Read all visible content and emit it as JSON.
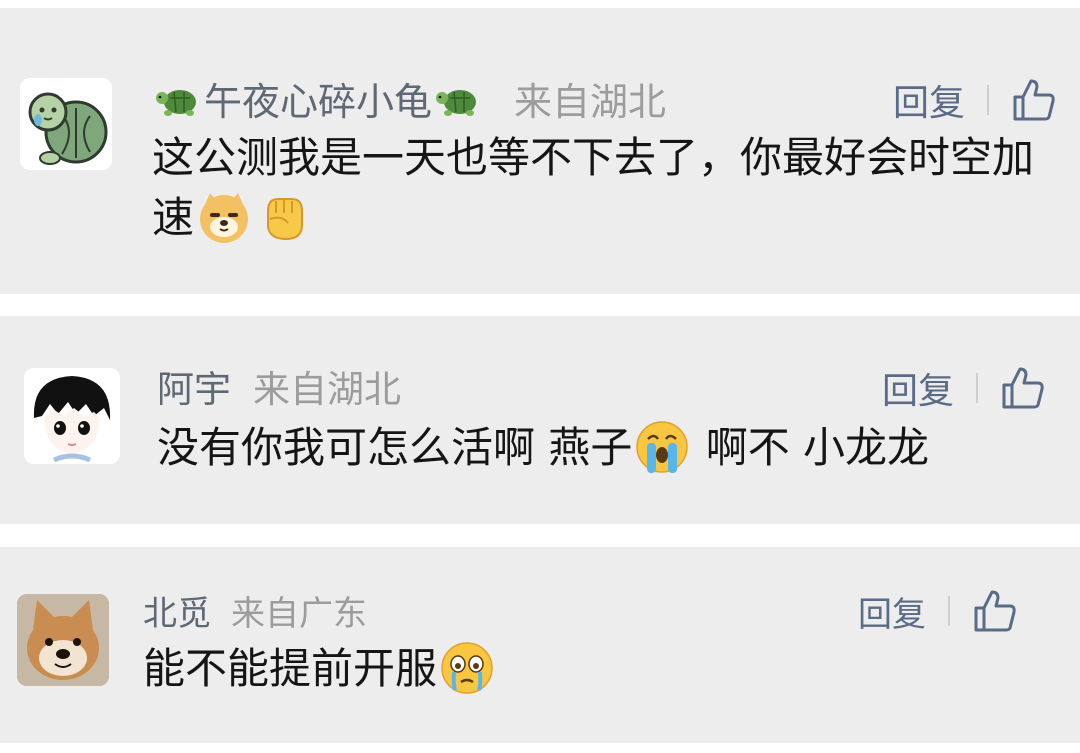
{
  "comments": [
    {
      "author": "午夜心碎小龟",
      "location": "来自湖北",
      "reply_label": "回复",
      "text_main": "这公测我是一天也等不下去了，你最好会时空加速",
      "emojis": [
        "doge-emoji",
        "fist-emoji"
      ]
    },
    {
      "author": "阿宇",
      "location": "来自湖北",
      "reply_label": "回复",
      "text_part1": "没有你我可怎么活啊 燕子",
      "text_part2": " 啊不 小龙龙",
      "emojis": [
        "crying-emoji"
      ]
    },
    {
      "author": "北觅",
      "location": "来自广东",
      "reply_label": "回复",
      "text_main": "能不能提前开服",
      "emojis": [
        "tearful-emoji"
      ]
    }
  ],
  "colors": {
    "card_bg": "#ededed",
    "name": "#5f6875",
    "location": "#9c9c9c",
    "reply": "#5a6b87",
    "text": "#151515"
  }
}
